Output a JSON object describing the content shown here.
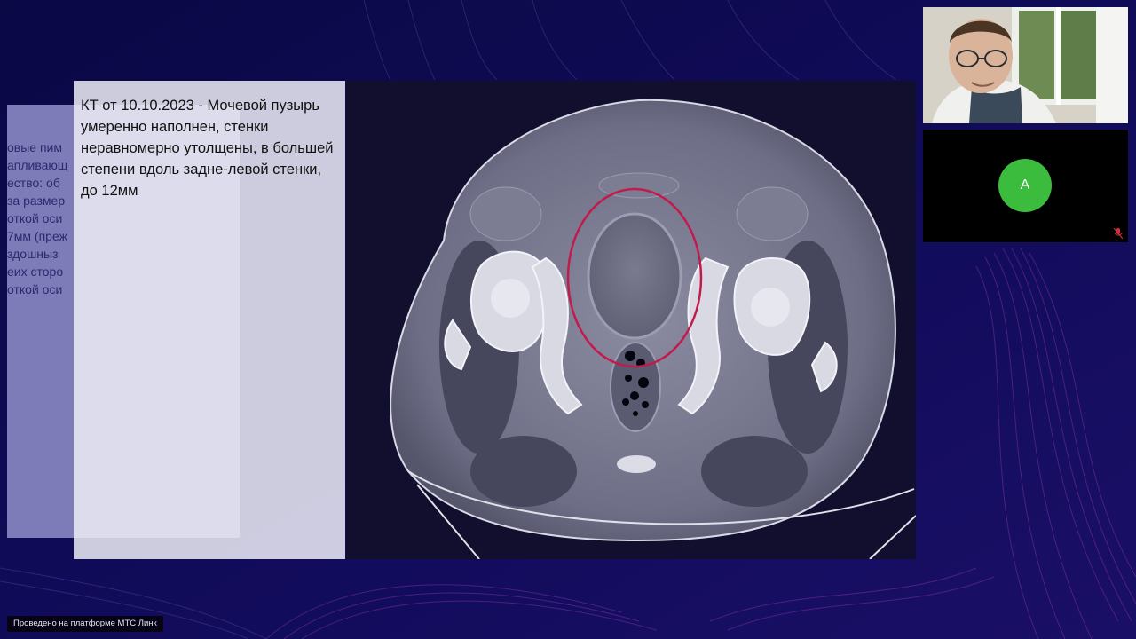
{
  "slide": {
    "main_text": "КТ от 10.10.2023 - Мочевой пузырь умеренно наполнен, стенки неравномерно утолщены, в большей степени вдоль задне-левой стенки, до 12мм",
    "ghost_lines": [
      "овые пим",
      "апливающ",
      "ество: об",
      "за размер",
      "откой оси",
      "7мм (преж",
      "здошныз",
      "еих сторо",
      "откой оси"
    ]
  },
  "participants": {
    "avatar_initial": "А"
  },
  "colors": {
    "background": "#0d0a52",
    "avatar": "#3cbc3c",
    "annotation_circle": "#c21a4a",
    "accent_lines": "#c040c0"
  },
  "footer": {
    "platform_label": "Проведено на платформе МТС Линк"
  }
}
